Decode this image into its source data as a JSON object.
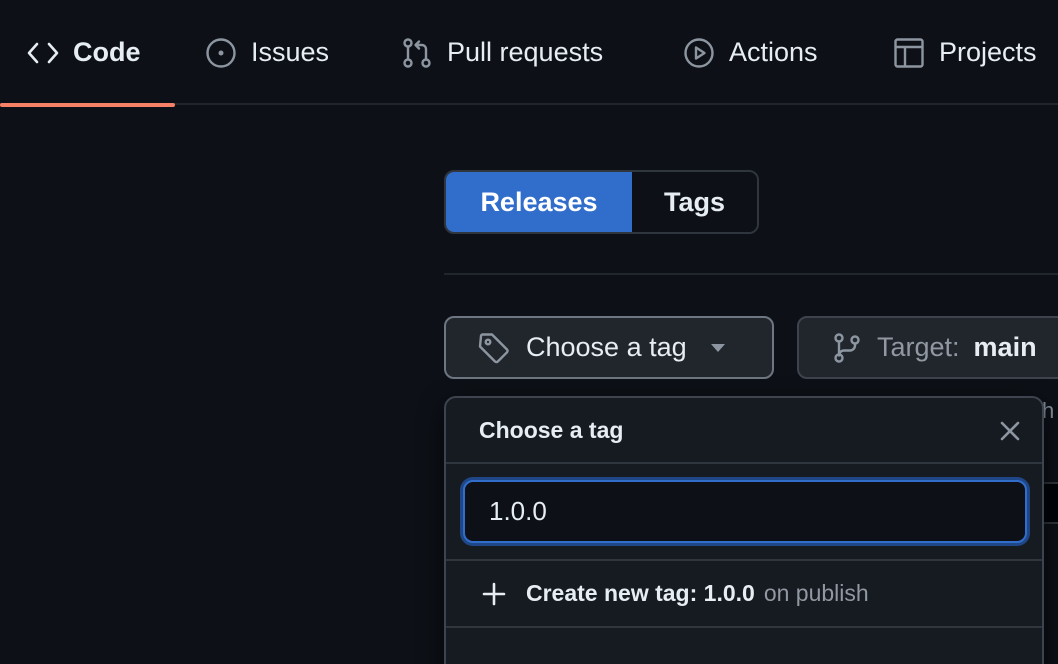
{
  "nav": {
    "items": [
      {
        "label": "Code",
        "icon": "code-icon",
        "selected": true
      },
      {
        "label": "Issues",
        "icon": "issue-opened-icon"
      },
      {
        "label": "Pull requests",
        "icon": "git-pull-request-icon"
      },
      {
        "label": "Actions",
        "icon": "play-icon"
      },
      {
        "label": "Projects",
        "icon": "table-icon"
      }
    ]
  },
  "subnav": {
    "releases_label": "Releases",
    "tags_label": "Tags"
  },
  "tag_button": {
    "label": "Choose a tag",
    "icon": "tag-icon"
  },
  "target_button": {
    "label": "Target:",
    "value": "main",
    "icon": "git-branch-icon"
  },
  "background_fragment": "h",
  "tag_dropdown": {
    "title": "Choose a tag",
    "input_value": "1.0.0",
    "create_label": "Create new tag: 1.0.0",
    "create_suffix": "on publish"
  },
  "colors": {
    "background": "#0d1117",
    "accent_blue": "#316dca",
    "nav_underline": "#f78166",
    "border": "#30363d"
  }
}
